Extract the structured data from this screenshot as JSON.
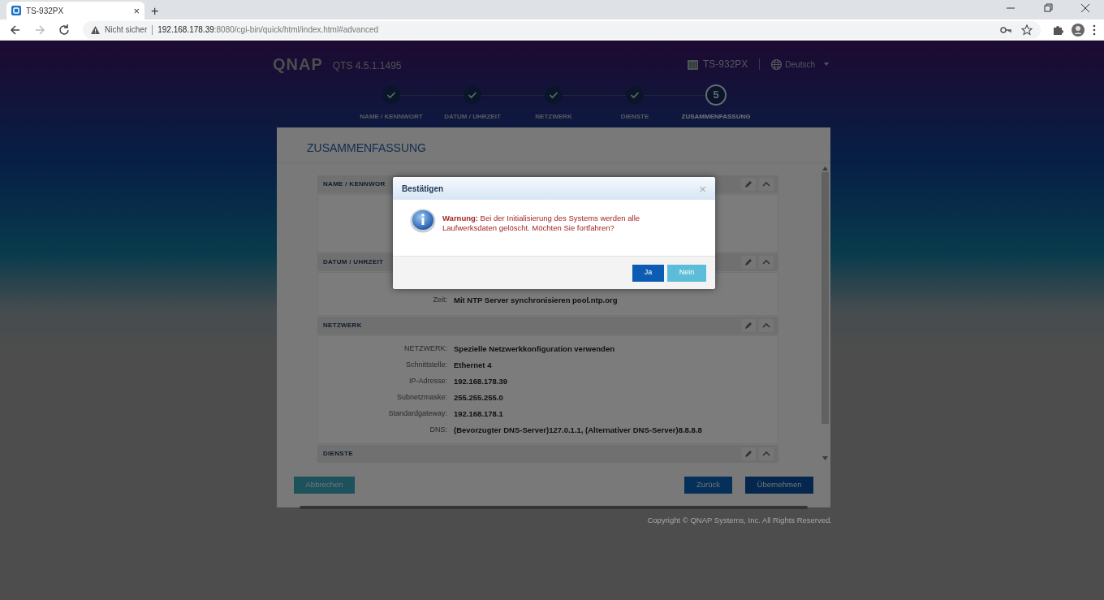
{
  "browser": {
    "tab": {
      "title": "TS-932PX",
      "close": "×"
    },
    "new_tab": "+",
    "nav_buttons": [
      {
        "kind": "back",
        "disabled": false
      },
      {
        "kind": "forward",
        "disabled": true
      },
      {
        "kind": "reload",
        "disabled": false
      }
    ],
    "address": {
      "security": "Nicht sicher",
      "host": "192.168.178.39",
      "path": ":8080/cgi-bin/quick/html/index.html#advanced"
    }
  },
  "header": {
    "logo": "QNAP",
    "version": "QTS 4.5.1.1495",
    "device": "TS-932PX",
    "language": "Deutsch"
  },
  "steps": [
    {
      "label": "NAME / KENNWORT",
      "done": true,
      "selected": false
    },
    {
      "label": "DATUM / UHRZEIT",
      "done": true,
      "selected": false
    },
    {
      "label": "NETZWERK",
      "done": true,
      "selected": false
    },
    {
      "label": "DIENSTE",
      "done": true,
      "selected": false
    },
    {
      "label": "ZUSAMMENFASSUNG",
      "done": false,
      "selected": true,
      "number": "5"
    }
  ],
  "summary": {
    "title": "ZUSAMMENFASSUNG",
    "sections": [
      {
        "title": "NAME / KENNWOR"
      },
      {
        "title": "DATUM / UHRZEIT",
        "rows": [
          {
            "label": "Zeit:",
            "value": "Mit NTP Server synchronisieren pool.ntp.org"
          }
        ]
      },
      {
        "title": "NETZWERK",
        "rows": [
          {
            "label": "NETZWERK:",
            "value": "Spezielle Netzwerkkonfiguration verwenden"
          },
          {
            "label": "Schnittstelle:",
            "value": "Ethernet 4"
          },
          {
            "label": "IP-Adresse:",
            "value": "192.168.178.39"
          },
          {
            "label": "Subnetzmaske:",
            "value": "255.255.255.0"
          },
          {
            "label": "Standardgateway:",
            "value": "192.168.178.1"
          },
          {
            "label": "DNS:",
            "value": "(Bevorzugter DNS-Server)127.0.1.1, (Alternativer DNS-Server)8.8.8.8"
          }
        ]
      },
      {
        "title": "DIENSTE"
      }
    ],
    "buttons": [
      {
        "label": "Abbrechen",
        "kind": "cancel"
      },
      {
        "label": "Zurück",
        "kind": "back"
      },
      {
        "label": "Übernehmen",
        "kind": "apply"
      }
    ]
  },
  "copyright": "Copyright © QNAP Systems, Inc. All Rights Reserved.",
  "dialog": {
    "title": "Bestätigen",
    "close": "×",
    "message": "**Warnung:** Bei der Initialisierung des Systems werden alle Laufwerksdaten gelöscht. Möchten Sie fortfahren?",
    "buttons": [
      {
        "label": "Ja",
        "kind": "primary"
      },
      {
        "label": "Nein",
        "kind": "secondary"
      }
    ]
  }
}
